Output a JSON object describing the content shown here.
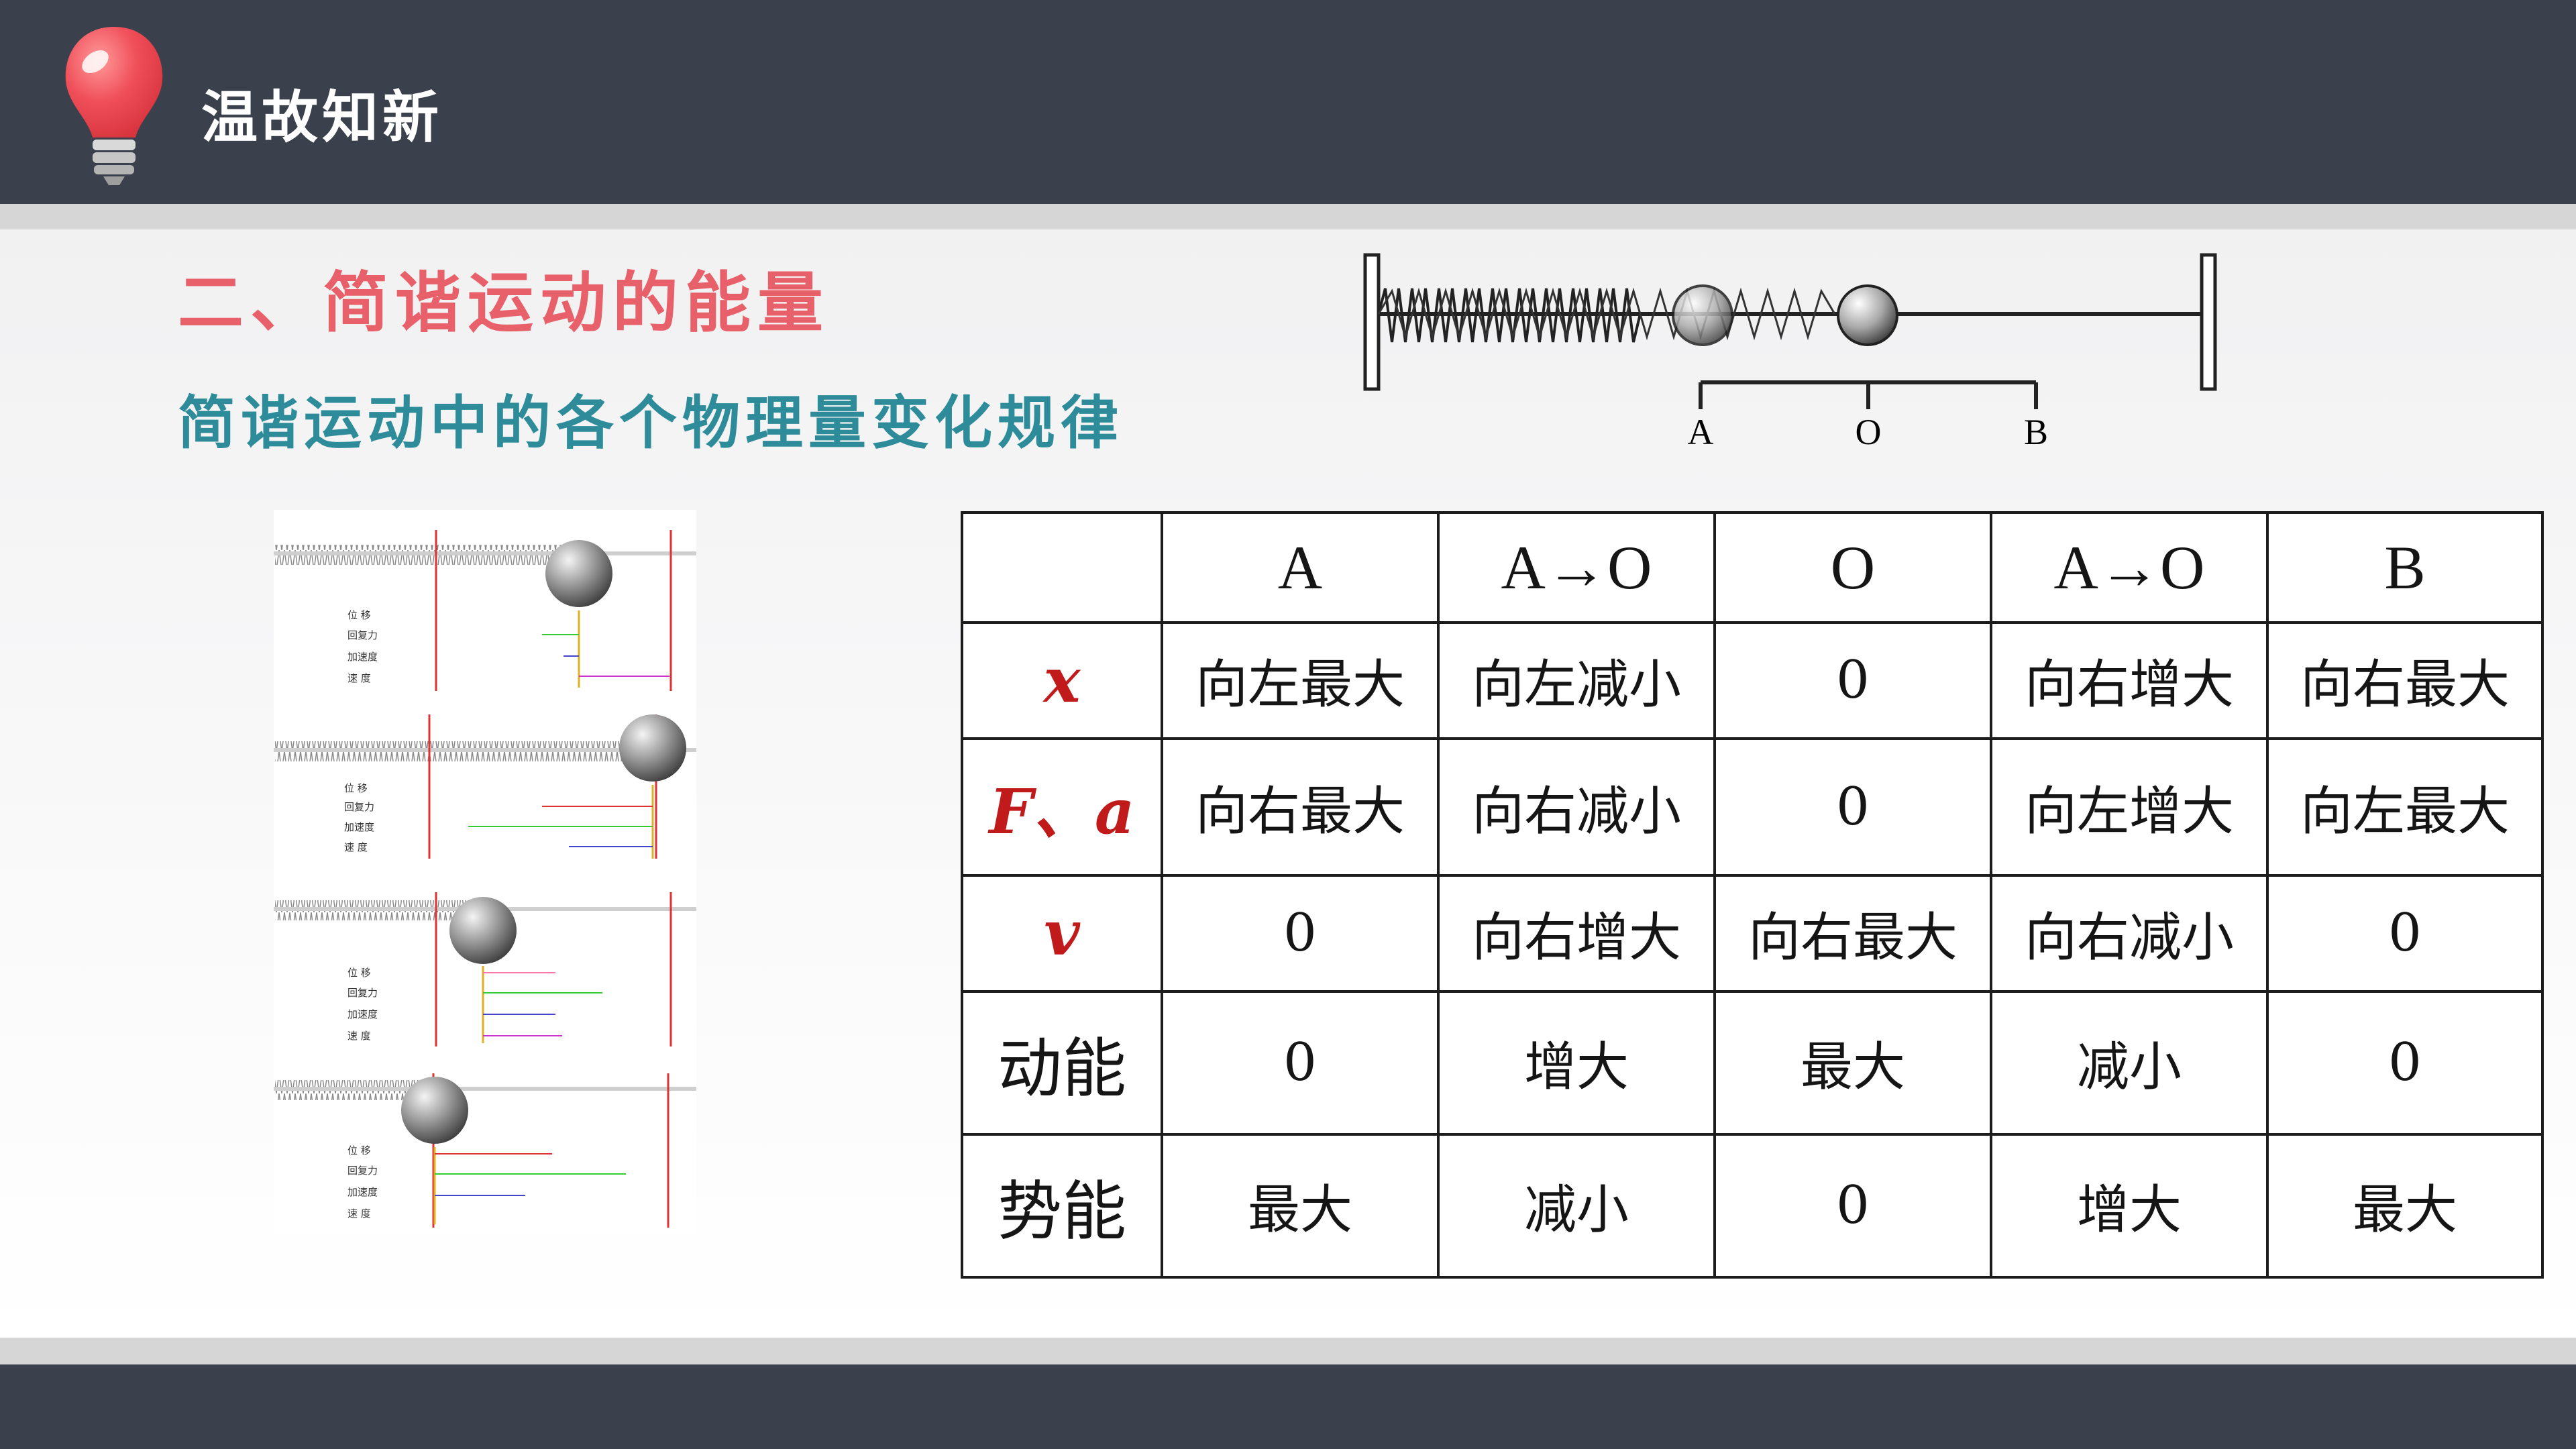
{
  "header": {
    "title": "温故知新"
  },
  "section_title": "二、简谐运动的能量",
  "subtitle": "简谐运动中的各个物理量变化规律",
  "figure": {
    "labels": [
      "A",
      "O",
      "B"
    ]
  },
  "diagrams": {
    "panel_labels": [
      "位 移",
      "回复力",
      "加速度",
      "速 度"
    ]
  },
  "table": {
    "headers": [
      "",
      "A",
      "A→O",
      "O",
      "A→O",
      "B"
    ],
    "rows": [
      {
        "label": "x",
        "cells": [
          "向左最大",
          "向左减小",
          "0",
          "向右增大",
          "向右最大"
        ]
      },
      {
        "label": "F、a",
        "cells": [
          "向右最大",
          "向右减小",
          "0",
          "向左增大",
          "向左最大"
        ]
      },
      {
        "label": "v",
        "cells": [
          "0",
          "向右增大",
          "向右最大",
          "向右减小",
          "0"
        ]
      },
      {
        "label": "动能",
        "cells": [
          "0",
          "增大",
          "最大",
          "减小",
          "0"
        ]
      },
      {
        "label": "势能",
        "cells": [
          "最大",
          "减小",
          "0",
          "增大",
          "最大"
        ]
      }
    ]
  },
  "colors": {
    "header_bg": "#3b414c",
    "title_red": "#e8606a",
    "subtitle_teal": "#2e8c9a",
    "symbol_red": "#c01a1a"
  }
}
